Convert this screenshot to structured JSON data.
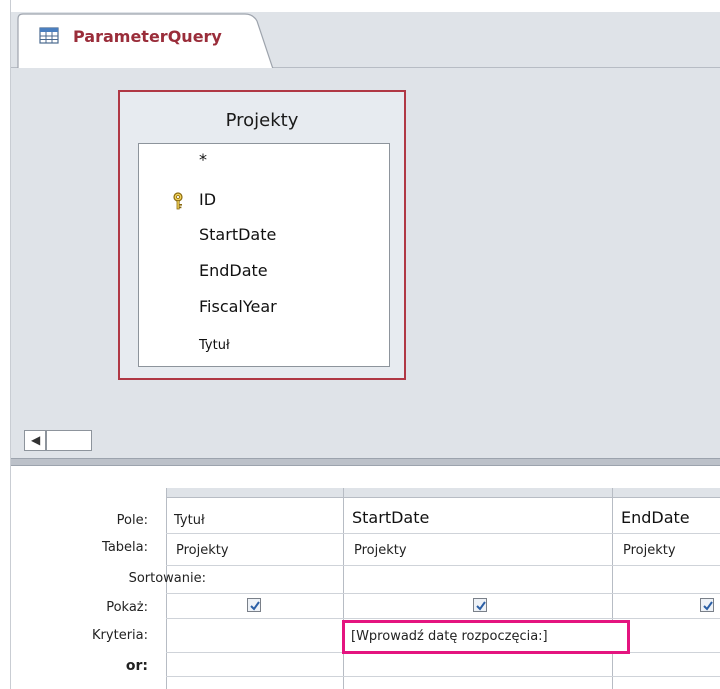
{
  "tab": {
    "title": "ParameterQuery",
    "icon": "query-table-icon"
  },
  "table": {
    "title": "Projekty",
    "fields": [
      {
        "label": "*"
      },
      {
        "label": "ID",
        "icon": "key-icon"
      },
      {
        "label": "StartDate"
      },
      {
        "label": "EndDate"
      },
      {
        "label": "FiscalYear"
      },
      {
        "label": "Tytuł"
      }
    ]
  },
  "grid": {
    "row_labels": {
      "field": "Pole:",
      "table": "Tabela:",
      "sort": "Sortowanie:",
      "show": "Pokaż:",
      "criteria": "Kryteria:",
      "or": "or:"
    },
    "columns": [
      {
        "field": "Tytuł",
        "table": "Projekty",
        "show": true,
        "criteria": ""
      },
      {
        "field": "StartDate",
        "table": "Projekty",
        "show": true,
        "criteria": "[Wprowadź datę rozpoczęcia:]"
      },
      {
        "field": "EndDate",
        "table": "Projekty",
        "show": true,
        "criteria": ""
      }
    ]
  },
  "colors": {
    "tab_text": "#9a2d3a",
    "table_border": "#b03845",
    "highlight": "#e4147f",
    "pane_bg": "#dfe3e8"
  },
  "scroll": {
    "left_arrow": "◀"
  }
}
